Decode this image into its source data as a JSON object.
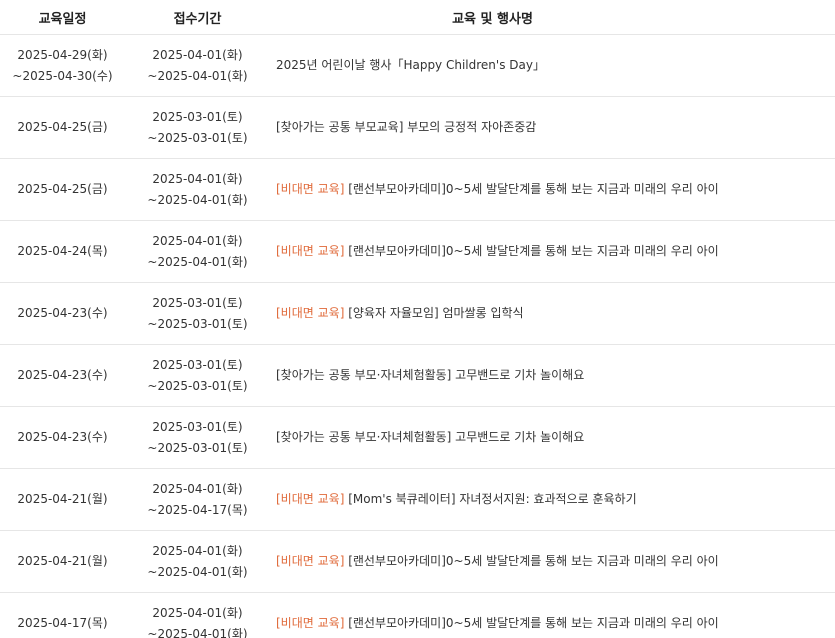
{
  "headers": {
    "date": "교육일정",
    "registration": "접수기간",
    "title": "교육 및 행사명"
  },
  "rows": [
    {
      "date_start": "2025-04-29(화)",
      "date_end": "~2025-04-30(수)",
      "reg_start": "2025-04-01(화)",
      "reg_end": "~2025-04-01(화)",
      "tag": "",
      "title": "2025년 어린이날 행사「Happy Children's Day」"
    },
    {
      "date_start": "2025-04-25(금)",
      "date_end": "",
      "reg_start": "2025-03-01(토)",
      "reg_end": "~2025-03-01(토)",
      "tag": "",
      "title": "[찾아가는 공통 부모교육] 부모의 긍정적 자아존중감"
    },
    {
      "date_start": "2025-04-25(금)",
      "date_end": "",
      "reg_start": "2025-04-01(화)",
      "reg_end": "~2025-04-01(화)",
      "tag": "[비대면 교육]",
      "title": " [랜선부모아카데미]0~5세 발달단계를 통해 보는 지금과 미래의 우리 아이"
    },
    {
      "date_start": "2025-04-24(목)",
      "date_end": "",
      "reg_start": "2025-04-01(화)",
      "reg_end": "~2025-04-01(화)",
      "tag": "[비대면 교육]",
      "title": " [랜선부모아카데미]0~5세 발달단계를 통해 보는 지금과 미래의 우리 아이"
    },
    {
      "date_start": "2025-04-23(수)",
      "date_end": "",
      "reg_start": "2025-03-01(토)",
      "reg_end": "~2025-03-01(토)",
      "tag": "[비대면 교육]",
      "title": " [양육자 자율모임] 엄마쌀롱 입학식"
    },
    {
      "date_start": "2025-04-23(수)",
      "date_end": "",
      "reg_start": "2025-03-01(토)",
      "reg_end": "~2025-03-01(토)",
      "tag": "",
      "title": "[찾아가는 공통 부모·자녀체험활동] 고무밴드로 기차 놀이해요"
    },
    {
      "date_start": "2025-04-23(수)",
      "date_end": "",
      "reg_start": "2025-03-01(토)",
      "reg_end": "~2025-03-01(토)",
      "tag": "",
      "title": "[찾아가는 공통 부모·자녀체험활동] 고무밴드로 기차 놀이해요"
    },
    {
      "date_start": "2025-04-21(월)",
      "date_end": "",
      "reg_start": "2025-04-01(화)",
      "reg_end": "~2025-04-17(목)",
      "tag": "[비대면 교육]",
      "title": " [Mom's 북큐레이터] 자녀정서지원: 효과적으로 훈육하기"
    },
    {
      "date_start": "2025-04-21(월)",
      "date_end": "",
      "reg_start": "2025-04-01(화)",
      "reg_end": "~2025-04-01(화)",
      "tag": "[비대면 교육]",
      "title": " [랜선부모아카데미]0~5세 발달단계를 통해 보는 지금과 미래의 우리 아이"
    },
    {
      "date_start": "2025-04-17(목)",
      "date_end": "",
      "reg_start": "2025-04-01(화)",
      "reg_end": "~2025-04-01(화)",
      "tag": "[비대면 교육]",
      "title": " [랜선부모아카데미]0~5세 발달단계를 통해 보는 지금과 미래의 우리 아이"
    }
  ]
}
